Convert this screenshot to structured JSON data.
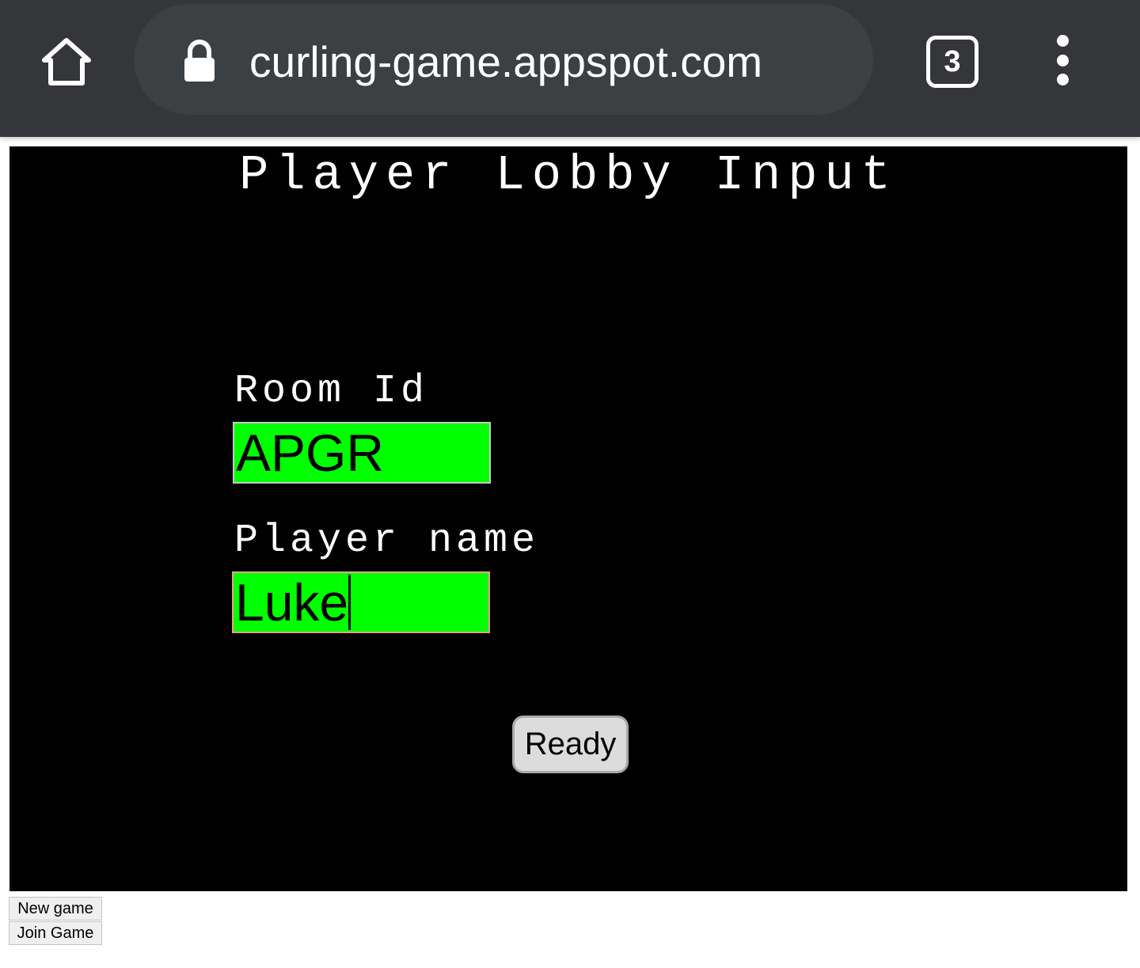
{
  "browser": {
    "url": "curling-game.appspot.com",
    "tab_count": "3",
    "icons": [
      "home-icon",
      "lock-icon",
      "tab-switcher-icon",
      "more-menu-icon"
    ]
  },
  "game": {
    "title": "Player Lobby Input",
    "room_label": "Room Id",
    "room_value": "APGR",
    "player_label": "Player name",
    "player_value": "Luke",
    "ready_label": "Ready"
  },
  "page_buttons": {
    "new_game": "New game",
    "join_game": "Join Game"
  },
  "colors": {
    "toolbar": "#35363a",
    "omnibox": "#3c4043",
    "canvas": "#000000",
    "field_fill": "#00ff00"
  }
}
